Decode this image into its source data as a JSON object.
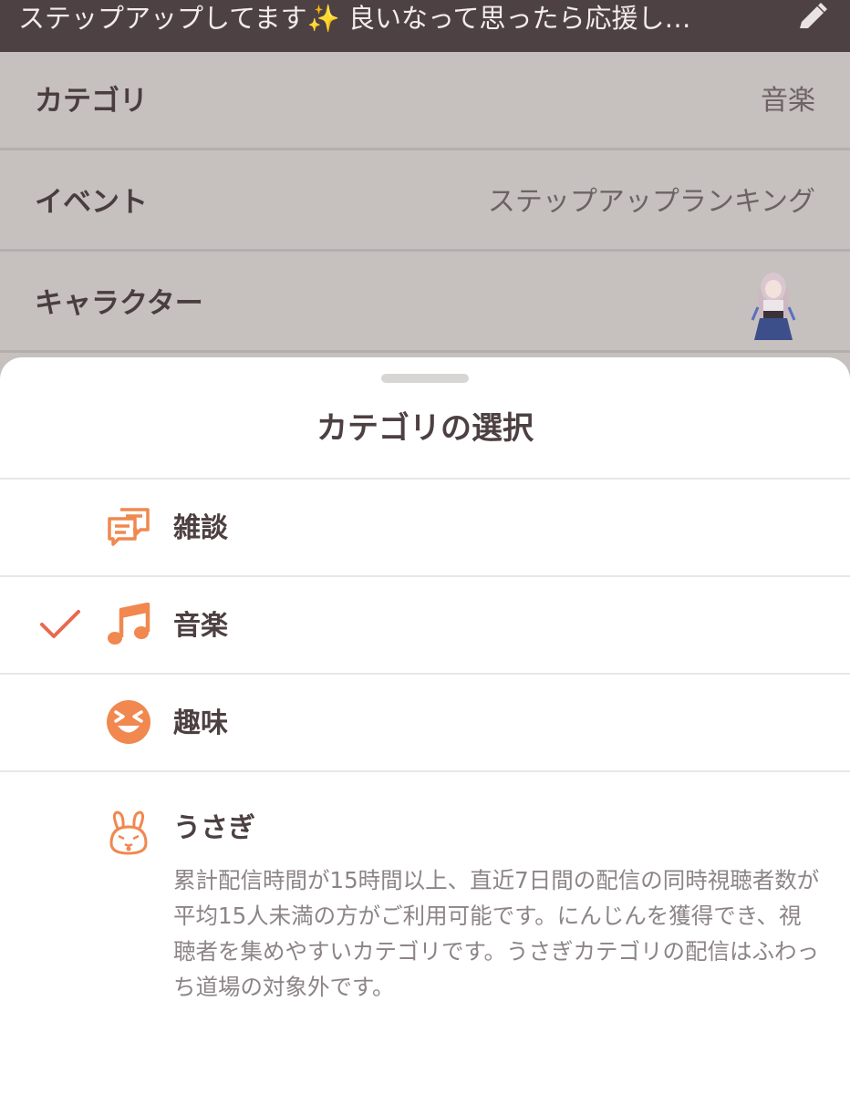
{
  "top_bar": {
    "title": "ステップアップしてます✨ 良いなって思ったら応援し…",
    "edit_icon": "pencil-icon"
  },
  "settings": [
    {
      "label": "カテゴリ",
      "value": "音楽"
    },
    {
      "label": "イベント",
      "value": "ステップアップランキング"
    },
    {
      "label": "キャラクター",
      "value": ""
    }
  ],
  "sheet": {
    "title": "カテゴリの選択",
    "options": [
      {
        "label": "雑談",
        "icon": "chat-bubbles-icon",
        "selected": false
      },
      {
        "label": "音楽",
        "icon": "music-note-icon",
        "selected": true
      },
      {
        "label": "趣味",
        "icon": "laughing-face-icon",
        "selected": false
      },
      {
        "label": "うさぎ",
        "icon": "rabbit-icon",
        "selected": false,
        "description": "累計配信時間が15時間以上、直近7日間の配信の同時視聴者数が平均15人未満の方がご利用可能です。にんじんを獲得でき、視聴者を集めやすいカテゴリです。うさぎカテゴリの配信はふわっち道場の対象外です。"
      }
    ]
  },
  "colors": {
    "accent": "#f0884f",
    "check": "#e8694f",
    "top_bar": "#4e4143",
    "overlay": "#c6c0bf"
  }
}
